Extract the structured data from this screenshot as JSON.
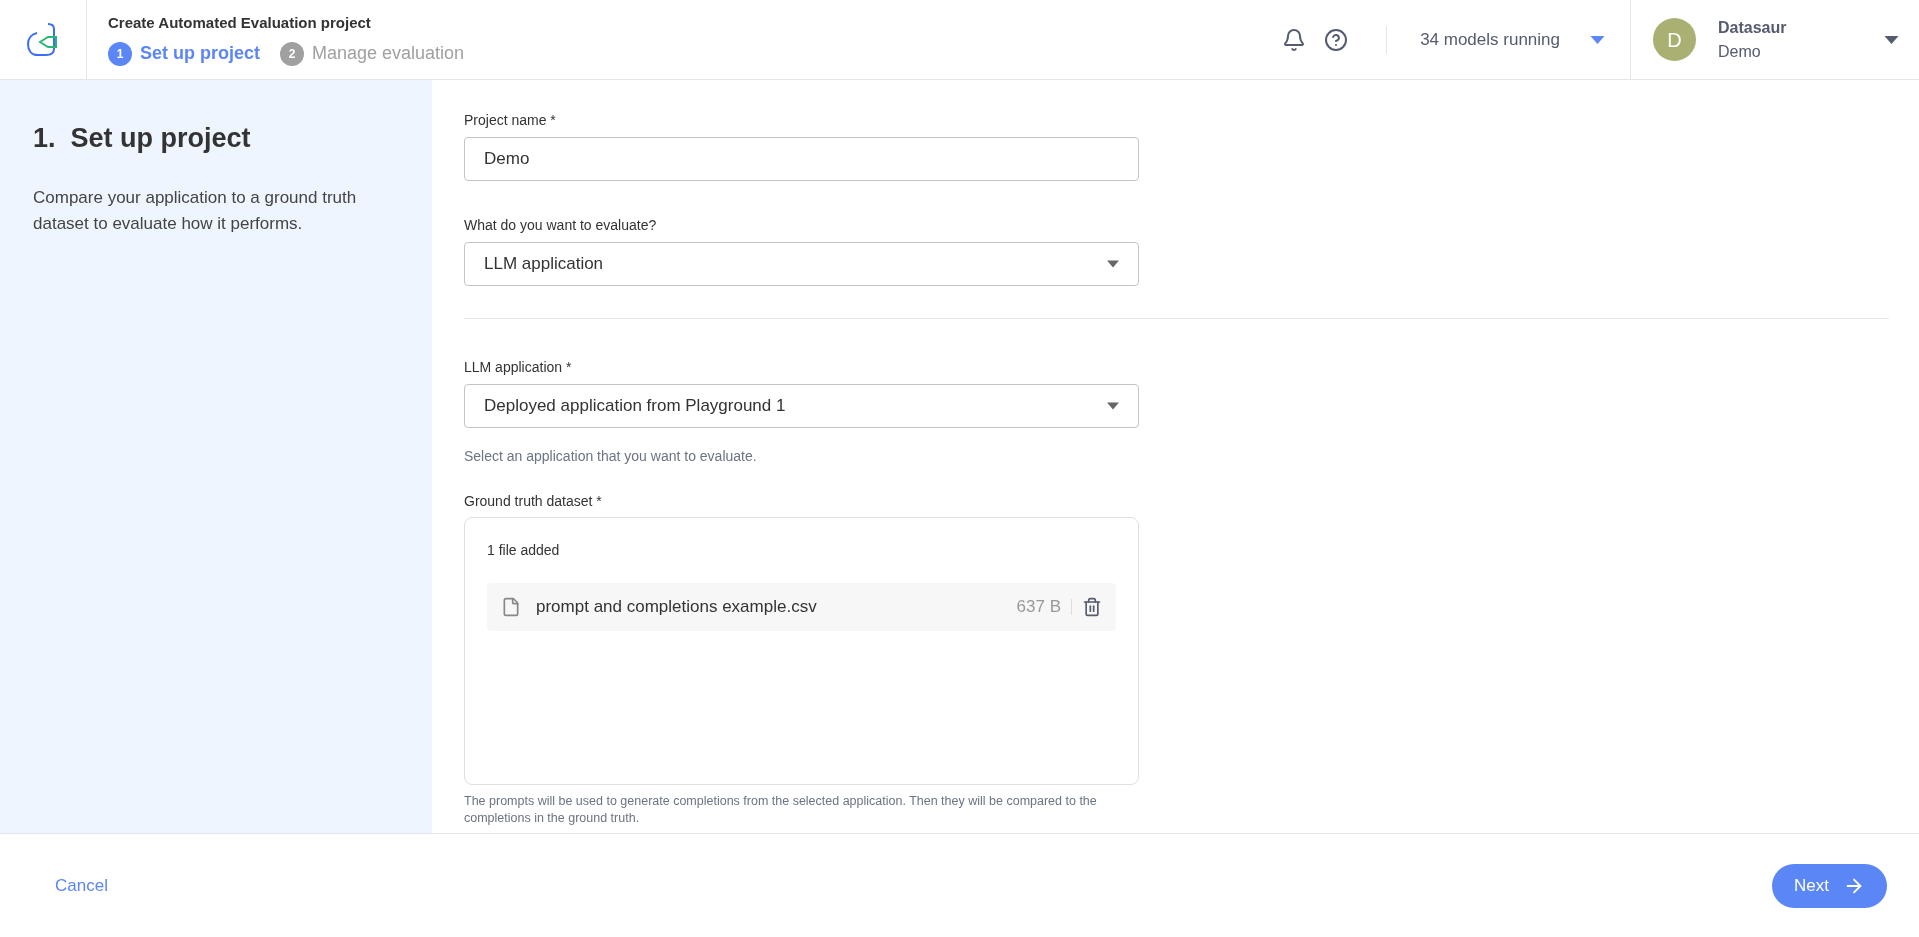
{
  "header": {
    "title": "Create Automated Evaluation project",
    "steps": [
      {
        "number": "1",
        "label": "Set up project",
        "selected": true
      },
      {
        "number": "2",
        "label": "Manage evaluation",
        "selected": false
      }
    ],
    "models_running": "34 models running",
    "user": {
      "initial": "D",
      "name": "Datasaur",
      "workspace": "Demo"
    }
  },
  "sidebar": {
    "title": "1.  Set up project",
    "description": "Compare your application to a ground truth dataset to evaluate how it performs."
  },
  "form": {
    "project_name": {
      "label": "Project name *",
      "value": "Demo"
    },
    "evaluate": {
      "label": "What do you want to evaluate?",
      "value": "LLM application"
    },
    "llm_application": {
      "label": "LLM application *",
      "value": "Deployed application from Playground 1",
      "helper": "Select an application that you want to evaluate."
    },
    "dataset": {
      "label": "Ground truth dataset *",
      "count": "1 file added",
      "files": [
        {
          "name": "prompt and completions example.csv",
          "size": "637 B"
        }
      ],
      "helper": "The prompts will be used to generate completions from the selected application. Then they will be compared to the completions in the ground truth."
    }
  },
  "footer": {
    "cancel": "Cancel",
    "next": "Next"
  }
}
